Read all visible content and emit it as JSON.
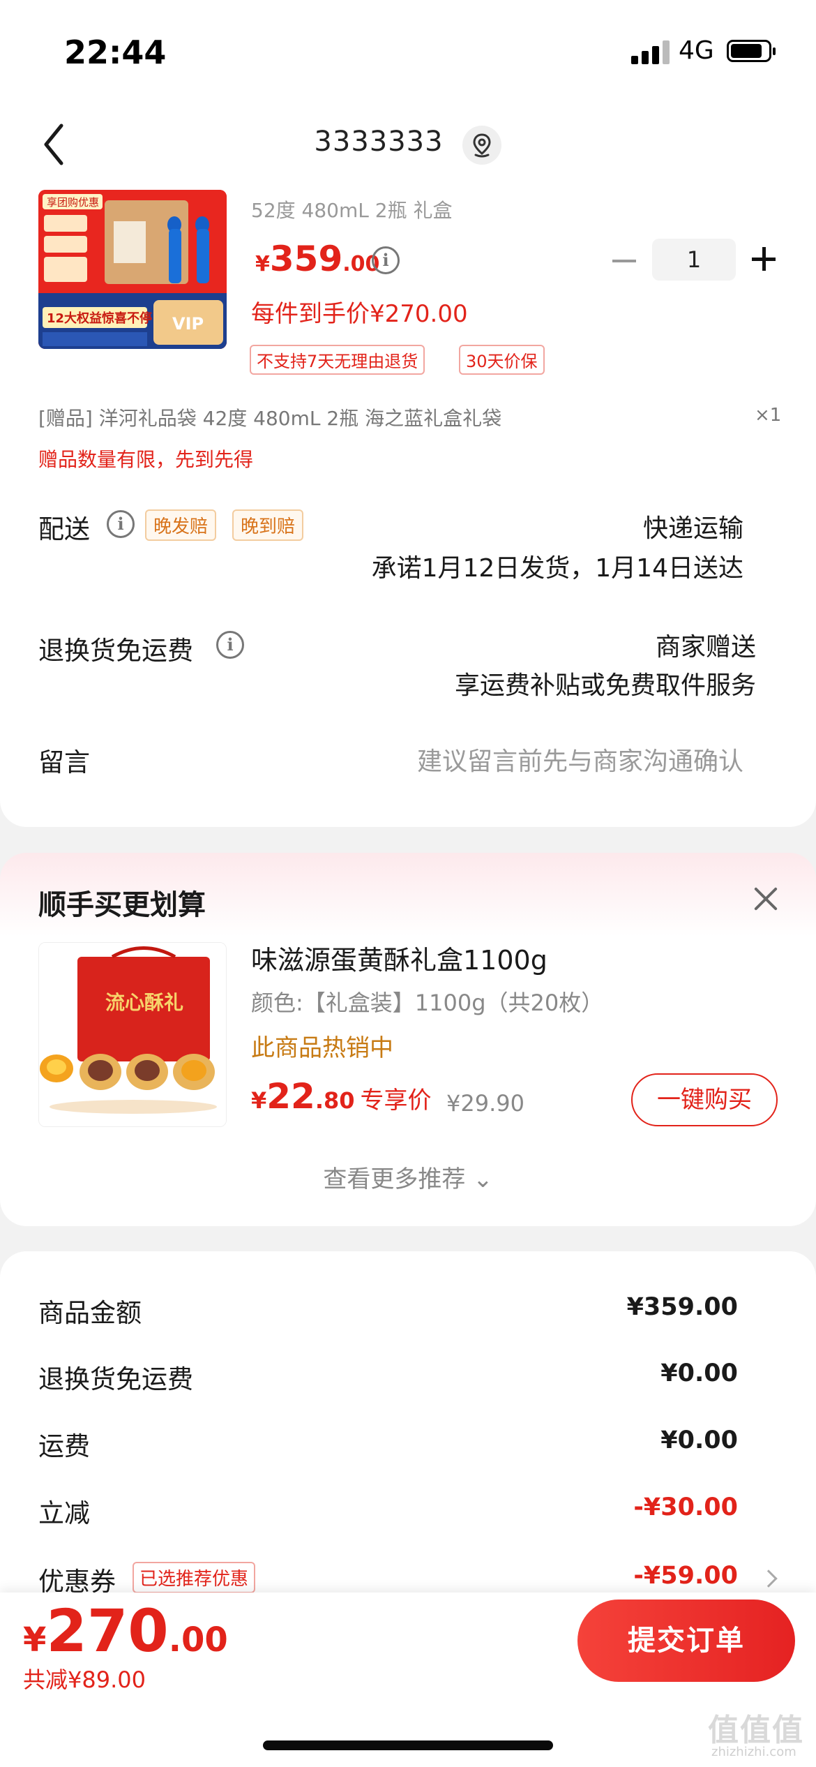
{
  "status_bar": {
    "time": "22:44",
    "network": "4G"
  },
  "header": {
    "title": "3333333"
  },
  "product": {
    "spec": "52度 480mL 2瓶 礼盒",
    "price_symbol": "¥",
    "price_int": "359",
    "price_dec": ".00",
    "quantity": "1",
    "net_price": "每件到手价¥270.00",
    "tags": [
      "不支持7天无理由退货",
      "30天价保"
    ],
    "gift": "[赠品] 洋河礼品袋 42度 480mL 2瓶 海之蓝礼盒礼袋",
    "gift_qty": "×1",
    "gift_note": "赠品数量有限，先到先得",
    "image_text": {
      "top_label": "享团购优惠",
      "banner": "12大权益惊喜不停",
      "vip": "VIP"
    }
  },
  "delivery": {
    "label": "配送",
    "tags": [
      "晚发赔",
      "晚到赔"
    ],
    "method": "快递运输",
    "promise": "承诺1月12日发货，1月14日送达"
  },
  "return_shipping": {
    "label": "退换货免运费",
    "value": "商家赠送",
    "desc": "享运费补贴或免费取件服务"
  },
  "message": {
    "label": "留言",
    "placeholder": "建议留言前先与商家沟通确认"
  },
  "upsell": {
    "title": "顺手买更划算",
    "name": "味滋源蛋黄酥礼盒1100g",
    "spec": "颜色:【礼盒装】1100g（共20枚）",
    "hot": "此商品热销中",
    "price_symbol": "¥",
    "price_int": "22",
    "price_dec": ".80",
    "price_label": "专享价",
    "orig_price": "¥29.90",
    "buy_label": "一键购买",
    "more_label": "查看更多推荐 ⌄",
    "image_text": "流心酥礼"
  },
  "summary": {
    "rows": [
      {
        "label": "商品金额",
        "value": "¥359.00"
      },
      {
        "label": "退换货免运费",
        "value": "¥0.00"
      },
      {
        "label": "运费",
        "value": "¥0.00"
      },
      {
        "label": "立减",
        "value": "-¥30.00"
      },
      {
        "label": "优惠券",
        "value": "-¥59.00"
      }
    ],
    "coupon_tag": "已选推荐优惠"
  },
  "footer": {
    "total_symbol": "¥",
    "total_int": "270",
    "total_dec": ".00",
    "saved": "共减¥89.00",
    "submit_label": "提交订单"
  },
  "watermark": {
    "text": "值值值",
    "url": "zhizhizhi.com"
  },
  "colors": {
    "accent": "#e2231a",
    "orange_tag": "#d8731a",
    "background": "#f2f2f2"
  }
}
